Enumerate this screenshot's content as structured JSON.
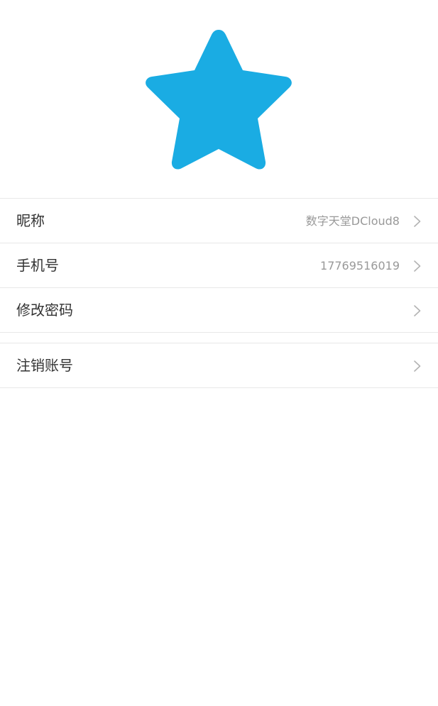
{
  "avatar": {
    "icon": "star-icon",
    "color": "#1aace3"
  },
  "menu": {
    "items": [
      {
        "label": "昵称",
        "value": "数字天堂DCloud8",
        "icon": "chevron-right-icon"
      },
      {
        "label": "手机号",
        "value": "17769516019",
        "icon": "chevron-right-icon"
      },
      {
        "label": "修改密码",
        "value": "",
        "icon": "chevron-right-icon"
      }
    ]
  },
  "account": {
    "deactivate_label": "注销账号",
    "icon": "chevron-right-icon"
  },
  "colors": {
    "divider": "#e8e8e8",
    "label_text": "#333333",
    "value_text": "#999999",
    "chevron": "#b3b3b3"
  }
}
